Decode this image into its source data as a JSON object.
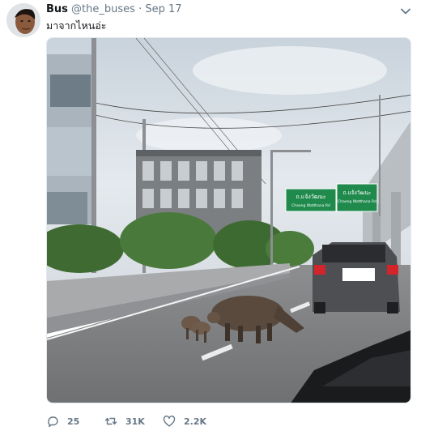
{
  "tweet": {
    "author_name": "Bus",
    "handle": "@the_buses",
    "separator": "·",
    "date": "Sep 17",
    "text": "มาจากไหนอ่ะ",
    "caret_icon": "chevron-down-icon"
  },
  "media": {
    "description_icon": "photo",
    "signs": {
      "left_title": "ถ.แจ้งวัฒนะ",
      "left_sub": "Chaeng Watthana Rd",
      "right_title": "ถ.แจ้งวัฒนะ",
      "right_sub": "Chaeng Watthana Rd"
    }
  },
  "actions": {
    "reply_count": "25",
    "retweet_count": "31K",
    "like_count": "2.2K"
  },
  "colors": {
    "text_primary": "#14171a",
    "text_secondary": "#657786",
    "sign_green": "#1f8a4c"
  }
}
